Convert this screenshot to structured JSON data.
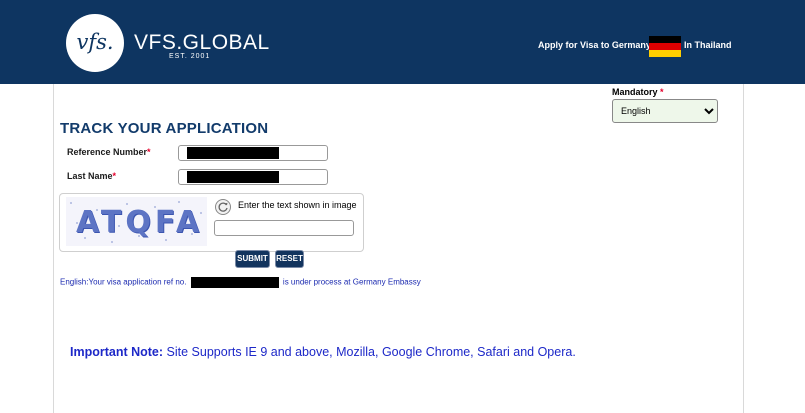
{
  "header": {
    "logo_text": "vfs.",
    "brand": "VFS.GLOBAL",
    "est": "EST. 2001",
    "apply_text": "Apply for Visa to Germany",
    "country_text": "In Thailand",
    "flag_colors": [
      "#000000",
      "#dd0000",
      "#ffce00"
    ]
  },
  "language": {
    "label": "Mandatory",
    "required_mark": "*",
    "selected": "English"
  },
  "form": {
    "title": "TRACK YOUR APPLICATION",
    "reference_label": "Reference Number",
    "last_name_label": "Last Name",
    "required_mark": "*"
  },
  "captcha": {
    "text": "ATQFA",
    "hint": "Enter the text shown in image"
  },
  "buttons": {
    "submit": "SUBMIT",
    "reset": "RESET"
  },
  "status": {
    "prefix": "English:Your visa application ref no.",
    "suffix": "is under process at Germany Embassy"
  },
  "note": {
    "label": "Important Note:",
    "text": "Site Supports IE 9 and above, Mozilla, Google Chrome, Safari and Opera."
  },
  "colors": {
    "header_bg": "#0e3561",
    "title": "#123b6b",
    "status_text": "#1c2bb0",
    "note_text": "#1d28c8"
  }
}
